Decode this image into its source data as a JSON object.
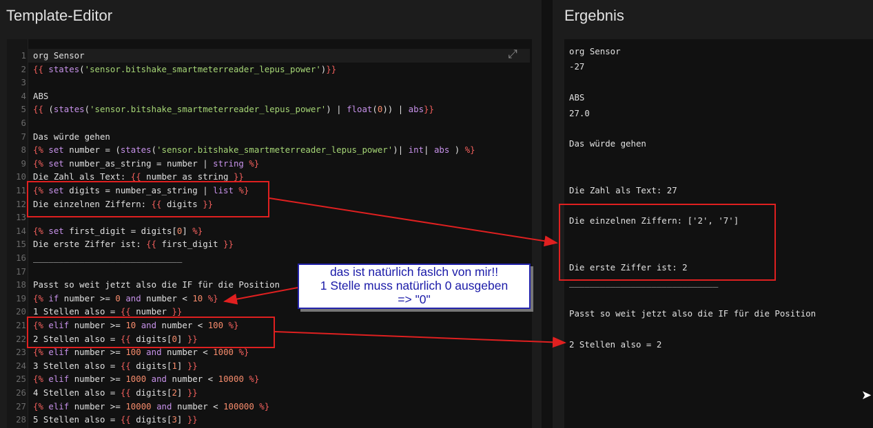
{
  "left_title": "Template-Editor",
  "right_title": "Ergebnis",
  "code_lines": [
    {
      "n": "1",
      "p": [
        [
          "v",
          "org Sensor"
        ]
      ]
    },
    {
      "n": "2",
      "p": [
        [
          "d",
          "{{ "
        ],
        [
          "k",
          "states"
        ],
        [
          "v",
          "("
        ],
        [
          "s",
          "'sensor.bitshake_smartmeterreader_lepus_power'"
        ],
        [
          "v",
          ")"
        ],
        [
          "d",
          "}}"
        ]
      ]
    },
    {
      "n": "3",
      "p": []
    },
    {
      "n": "4",
      "p": [
        [
          "v",
          "ABS"
        ]
      ]
    },
    {
      "n": "5",
      "p": [
        [
          "d",
          "{{ "
        ],
        [
          "v",
          "("
        ],
        [
          "k",
          "states"
        ],
        [
          "v",
          "("
        ],
        [
          "s",
          "'sensor.bitshake_smartmeterreader_lepus_power'"
        ],
        [
          "v",
          ") | "
        ],
        [
          "k",
          "float"
        ],
        [
          "v",
          "("
        ],
        [
          "n",
          "0"
        ],
        [
          "v",
          ")) | "
        ],
        [
          "k",
          "abs"
        ],
        [
          "d",
          "}}"
        ]
      ]
    },
    {
      "n": "6",
      "p": []
    },
    {
      "n": "7",
      "p": [
        [
          "v",
          "Das würde gehen"
        ]
      ]
    },
    {
      "n": "8",
      "p": [
        [
          "d",
          "{% "
        ],
        [
          "k",
          "set "
        ],
        [
          "v",
          "number = ("
        ],
        [
          "k",
          "states"
        ],
        [
          "v",
          "("
        ],
        [
          "s",
          "'sensor.bitshake_smartmeterreader_lepus_power'"
        ],
        [
          "v",
          ")| "
        ],
        [
          "k",
          "int"
        ],
        [
          "v",
          "| "
        ],
        [
          "k",
          "abs"
        ],
        [
          "v",
          " ) "
        ],
        [
          "d",
          "%}"
        ]
      ]
    },
    {
      "n": "9",
      "p": [
        [
          "d",
          "{% "
        ],
        [
          "k",
          "set "
        ],
        [
          "v",
          "number_as_string = number | "
        ],
        [
          "k",
          "string"
        ],
        [
          "d",
          " %}"
        ]
      ]
    },
    {
      "n": "10",
      "p": [
        [
          "v",
          "Die Zahl als Text: "
        ],
        [
          "d",
          "{{ "
        ],
        [
          "v",
          "number_as_string "
        ],
        [
          "d",
          "}}"
        ]
      ]
    },
    {
      "n": "11",
      "p": [
        [
          "d",
          "{% "
        ],
        [
          "k",
          "set "
        ],
        [
          "v",
          "digits = number_as_string | "
        ],
        [
          "k",
          "list"
        ],
        [
          "d",
          " %}"
        ]
      ]
    },
    {
      "n": "12",
      "p": [
        [
          "v",
          "Die einzelnen Ziffern: "
        ],
        [
          "d",
          "{{ "
        ],
        [
          "v",
          "digits "
        ],
        [
          "d",
          "}}"
        ]
      ]
    },
    {
      "n": "13",
      "p": []
    },
    {
      "n": "14",
      "p": [
        [
          "d",
          "{% "
        ],
        [
          "k",
          "set "
        ],
        [
          "v",
          "first_digit = digits["
        ],
        [
          "n",
          "0"
        ],
        [
          "v",
          "] "
        ],
        [
          "d",
          "%}"
        ]
      ]
    },
    {
      "n": "15",
      "p": [
        [
          "v",
          "Die erste Ziffer ist: "
        ],
        [
          "d",
          "{{ "
        ],
        [
          "v",
          "first_digit "
        ],
        [
          "d",
          "}}"
        ]
      ]
    },
    {
      "n": "16",
      "p": [
        [
          "v",
          "_____________________________"
        ]
      ]
    },
    {
      "n": "17",
      "p": []
    },
    {
      "n": "18",
      "p": [
        [
          "v",
          "Passt so weit jetzt also die IF für die Position"
        ]
      ]
    },
    {
      "n": "19",
      "p": [
        [
          "d",
          "{% "
        ],
        [
          "k",
          "if "
        ],
        [
          "v",
          "number >= "
        ],
        [
          "n",
          "0"
        ],
        [
          "k",
          " and "
        ],
        [
          "v",
          "number < "
        ],
        [
          "n",
          "10"
        ],
        [
          "d",
          " %}"
        ]
      ]
    },
    {
      "n": "20",
      "p": [
        [
          "v",
          "1 Stellen also = "
        ],
        [
          "d",
          "{{ "
        ],
        [
          "v",
          "number "
        ],
        [
          "d",
          "}}"
        ]
      ]
    },
    {
      "n": "21",
      "p": [
        [
          "d",
          "{% "
        ],
        [
          "k",
          "elif "
        ],
        [
          "v",
          "number >= "
        ],
        [
          "n",
          "10"
        ],
        [
          "k",
          " and "
        ],
        [
          "v",
          "number < "
        ],
        [
          "n",
          "100"
        ],
        [
          "d",
          " %}"
        ]
      ]
    },
    {
      "n": "22",
      "p": [
        [
          "v",
          "2 Stellen also = "
        ],
        [
          "d",
          "{{ "
        ],
        [
          "v",
          "digits["
        ],
        [
          "n",
          "0"
        ],
        [
          "v",
          "] "
        ],
        [
          "d",
          "}}"
        ]
      ]
    },
    {
      "n": "23",
      "p": [
        [
          "d",
          "{% "
        ],
        [
          "k",
          "elif "
        ],
        [
          "v",
          "number >= "
        ],
        [
          "n",
          "100"
        ],
        [
          "k",
          " and "
        ],
        [
          "v",
          "number < "
        ],
        [
          "n",
          "1000"
        ],
        [
          "d",
          " %}"
        ]
      ]
    },
    {
      "n": "24",
      "p": [
        [
          "v",
          "3 Stellen also = "
        ],
        [
          "d",
          "{{ "
        ],
        [
          "v",
          "digits["
        ],
        [
          "n",
          "1"
        ],
        [
          "v",
          "] "
        ],
        [
          "d",
          "}}"
        ]
      ]
    },
    {
      "n": "25",
      "p": [
        [
          "d",
          "{% "
        ],
        [
          "k",
          "elif "
        ],
        [
          "v",
          "number >= "
        ],
        [
          "n",
          "1000"
        ],
        [
          "k",
          " and "
        ],
        [
          "v",
          "number < "
        ],
        [
          "n",
          "10000"
        ],
        [
          "d",
          " %}"
        ]
      ]
    },
    {
      "n": "26",
      "p": [
        [
          "v",
          "4 Stellen also = "
        ],
        [
          "d",
          "{{ "
        ],
        [
          "v",
          "digits["
        ],
        [
          "n",
          "2"
        ],
        [
          "v",
          "] "
        ],
        [
          "d",
          "}}"
        ]
      ]
    },
    {
      "n": "27",
      "p": [
        [
          "d",
          "{% "
        ],
        [
          "k",
          "elif "
        ],
        [
          "v",
          "number >= "
        ],
        [
          "n",
          "10000"
        ],
        [
          "k",
          " and "
        ],
        [
          "v",
          "number < "
        ],
        [
          "n",
          "100000"
        ],
        [
          "d",
          " %}"
        ]
      ]
    },
    {
      "n": "28",
      "p": [
        [
          "v",
          "5 Stellen also = "
        ],
        [
          "d",
          "{{ "
        ],
        [
          "v",
          "digits["
        ],
        [
          "n",
          "3"
        ],
        [
          "v",
          "] "
        ],
        [
          "d",
          "}}"
        ]
      ]
    }
  ],
  "result_lines": [
    "org Sensor",
    "-27",
    "",
    "ABS",
    "27.0",
    "",
    "Das würde gehen",
    "",
    "",
    "Die Zahl als Text: 27",
    "",
    "Die einzelnen Ziffern: ['2', '7']",
    "",
    "",
    "Die erste Ziffer ist: 2",
    "_____________________________",
    "",
    "Passt so weit jetzt also die IF für die Position",
    "",
    "2 Stellen also = 2"
  ],
  "annotation": {
    "note_lines": [
      "das ist natürlich faslch von mir!!",
      "1 Stelle muss natürlich 0 ausgeben",
      "=> \"0\""
    ]
  },
  "colors": {
    "delimiter": "#f25f5c",
    "string": "#a6d676",
    "keyword": "#c792ea",
    "number": "#f78c6c",
    "annotation_red": "#e02020",
    "annotation_blue": "#1a1aa8"
  },
  "icons": {
    "expand": "fullscreen-expand-icon",
    "mouse": "mouse-pointer-icon"
  }
}
